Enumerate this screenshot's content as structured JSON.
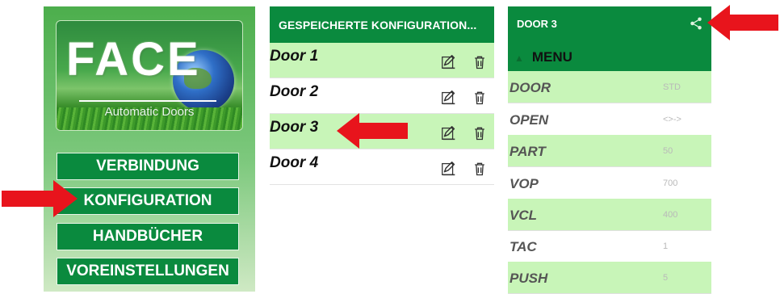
{
  "home": {
    "logo": {
      "title": "FACE",
      "subtitle": "Automatic Doors"
    },
    "buttons": [
      {
        "label": "VERBINDUNG"
      },
      {
        "label": "KONFIGURATION"
      },
      {
        "label": "HANDBÜCHER"
      },
      {
        "label": "VOREINSTELLUNGEN"
      }
    ]
  },
  "saved": {
    "title": "GESPEICHERTE KONFIGURATION...",
    "items": [
      {
        "name": "Door 1",
        "highlighted": true
      },
      {
        "name": "Door 2",
        "highlighted": false
      },
      {
        "name": "Door 3",
        "highlighted": true
      },
      {
        "name": "Door 4",
        "highlighted": false
      }
    ]
  },
  "detail": {
    "title": "DOOR 3",
    "menu_label": "MENU",
    "params": [
      {
        "key": "DOOR",
        "value": "STD"
      },
      {
        "key": "OPEN",
        "value": "<>->"
      },
      {
        "key": "PART",
        "value": "50"
      },
      {
        "key": "VOP",
        "value": "700"
      },
      {
        "key": "VCL",
        "value": "400"
      },
      {
        "key": "TAC",
        "value": "1"
      },
      {
        "key": "PUSH",
        "value": "5"
      }
    ]
  },
  "colors": {
    "primary": "#0a8a3e",
    "row_highlight": "#c8f5b8",
    "arrow": "#e8141c"
  },
  "icons": [
    "edit-icon",
    "delete-icon",
    "share-icon",
    "chevron-up-icon",
    "arrow-right-icon",
    "arrow-left-icon"
  ]
}
